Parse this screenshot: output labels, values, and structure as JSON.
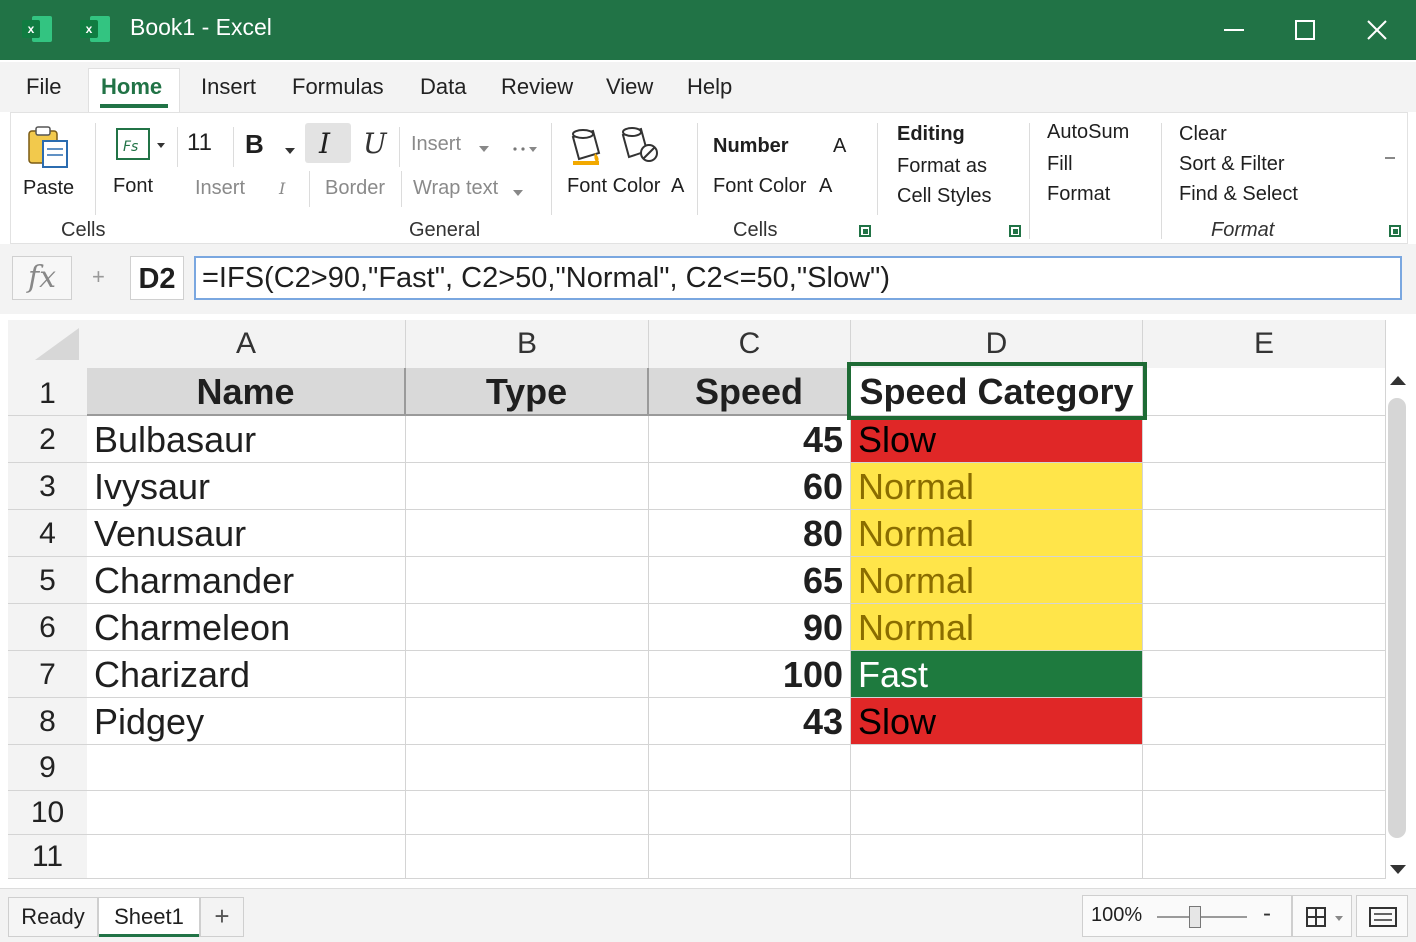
{
  "window": {
    "title": "Book1 - Excel",
    "logo_letter": "x"
  },
  "menu": {
    "tabs": [
      "File",
      "Home",
      "Insert",
      "Formulas",
      "Data",
      "Review",
      "View",
      "Help"
    ],
    "active": "Home"
  },
  "ribbon": {
    "paste": "Paste",
    "font": "Font",
    "font_size": "11",
    "bold": "B",
    "italic": "I",
    "underline": "U",
    "insert_top": "Insert",
    "insert_bottom": "Insert",
    "italic_small": "I",
    "border": "Border",
    "wrap_text": "Wrap text",
    "font_color_1": "Font Color",
    "font_color_1_glyph": "A",
    "number": "Number",
    "number_glyph": "A",
    "font_color_2": "Font Color",
    "font_color_2_glyph": "A",
    "editing": "Editing",
    "format_as": "Format as",
    "cell_styles": "Cell Styles",
    "autosum": "AutoSum",
    "fill": "Fill",
    "format": "Format",
    "clear": "Clear",
    "sort_filter": "Sort & Filter",
    "find_select": "Find & Select",
    "groups": {
      "cells_1": "Cells",
      "general": "General",
      "cells_2": "Cells",
      "format": "Format"
    }
  },
  "formula_bar": {
    "fx": "fx",
    "name_box": "D2",
    "formula": "=IFS(C2>90,\"Fast\", C2>50,\"Normal\", C2<=50,\"Slow\")"
  },
  "sheet": {
    "columns": [
      "A",
      "B",
      "C",
      "D",
      "E"
    ],
    "row_numbers": [
      "1",
      "2",
      "3",
      "4",
      "5",
      "6",
      "7",
      "8",
      "9",
      "10",
      "11"
    ],
    "headers": {
      "a": "Name",
      "b": "Type",
      "c": "Speed",
      "d": "Speed Category"
    },
    "rows": [
      {
        "name": "Bulbasaur",
        "type": "",
        "speed": "45",
        "category": "Slow"
      },
      {
        "name": "Ivysaur",
        "type": "",
        "speed": "60",
        "category": "Normal"
      },
      {
        "name": "Venusaur",
        "type": "",
        "speed": "80",
        "category": "Normal"
      },
      {
        "name": "Charmander",
        "type": "",
        "speed": "65",
        "category": "Normal"
      },
      {
        "name": "Charmeleon",
        "type": "",
        "speed": "90",
        "category": "Normal"
      },
      {
        "name": "Charizard",
        "type": "",
        "speed": "100",
        "category": "Fast"
      },
      {
        "name": "Pidgey",
        "type": "",
        "speed": "43",
        "category": "Slow"
      }
    ],
    "active_cell": "D1"
  },
  "status_bar": {
    "status": "Ready",
    "sheet_tab": "Sheet1",
    "add_sheet": "+",
    "zoom": "100%",
    "zoom_minus": "-"
  },
  "colors": {
    "brand_green": "#217346",
    "slow": "#e02727",
    "normal": "#ffe54a",
    "fast": "#1e7a3e"
  }
}
